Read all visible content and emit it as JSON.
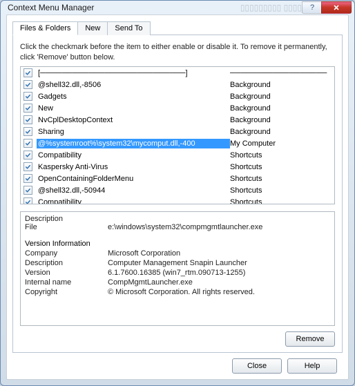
{
  "window": {
    "title": "Context Menu Manager",
    "blurred_bg_text": "▯▯▯▯▯▯▯▯▯ ▯▯▯▯"
  },
  "tabs": [
    {
      "label": "Files & Folders",
      "active": true
    },
    {
      "label": "New",
      "active": false
    },
    {
      "label": "Send To",
      "active": false
    }
  ],
  "hint": "Click the checkmark before the item to either enable or disable it. To remove it permanently, click 'Remove' button below.",
  "list": {
    "items": [
      {
        "checked": true,
        "name": "[───────────────────────────]",
        "category": "──────────────────",
        "selected": false
      },
      {
        "checked": true,
        "name": "@shell32.dll,-8506",
        "category": "Background",
        "selected": false
      },
      {
        "checked": true,
        "name": "Gadgets",
        "category": "Background",
        "selected": false
      },
      {
        "checked": true,
        "name": "New",
        "category": "Background",
        "selected": false
      },
      {
        "checked": true,
        "name": "NvCplDesktopContext",
        "category": "Background",
        "selected": false
      },
      {
        "checked": true,
        "name": "Sharing",
        "category": "Background",
        "selected": false
      },
      {
        "checked": true,
        "name": "@%systemroot%\\system32\\mycomput.dll,-400",
        "category": "My Computer",
        "selected": true
      },
      {
        "checked": true,
        "name": "Compatibility",
        "category": "Shortcuts",
        "selected": false
      },
      {
        "checked": true,
        "name": "Kaspersky Anti-Virus",
        "category": "Shortcuts",
        "selected": false
      },
      {
        "checked": true,
        "name": "OpenContainingFolderMenu",
        "category": "Shortcuts",
        "selected": false
      },
      {
        "checked": true,
        "name": "@shell32.dll,-50944",
        "category": "Shortcuts",
        "selected": false
      },
      {
        "checked": true,
        "name": "Compatibility",
        "category": "Shortcuts",
        "selected": false
      }
    ]
  },
  "details": {
    "header_description": "Description",
    "rows1": [
      {
        "k": "File",
        "v": "e:\\windows\\system32\\compmgmtlauncher.exe"
      }
    ],
    "header_version": "Version Information",
    "rows2": [
      {
        "k": "Company",
        "v": "Microsoft Corporation"
      },
      {
        "k": "Description",
        "v": "Computer Management Snapin Launcher"
      },
      {
        "k": "Version",
        "v": "6.1.7600.16385 (win7_rtm.090713-1255)"
      },
      {
        "k": "Internal name",
        "v": "CompMgmtLauncher.exe"
      },
      {
        "k": "Copyright",
        "v": "© Microsoft Corporation. All rights reserved."
      }
    ]
  },
  "buttons": {
    "remove": "Remove",
    "close": "Close",
    "help": "Help"
  }
}
